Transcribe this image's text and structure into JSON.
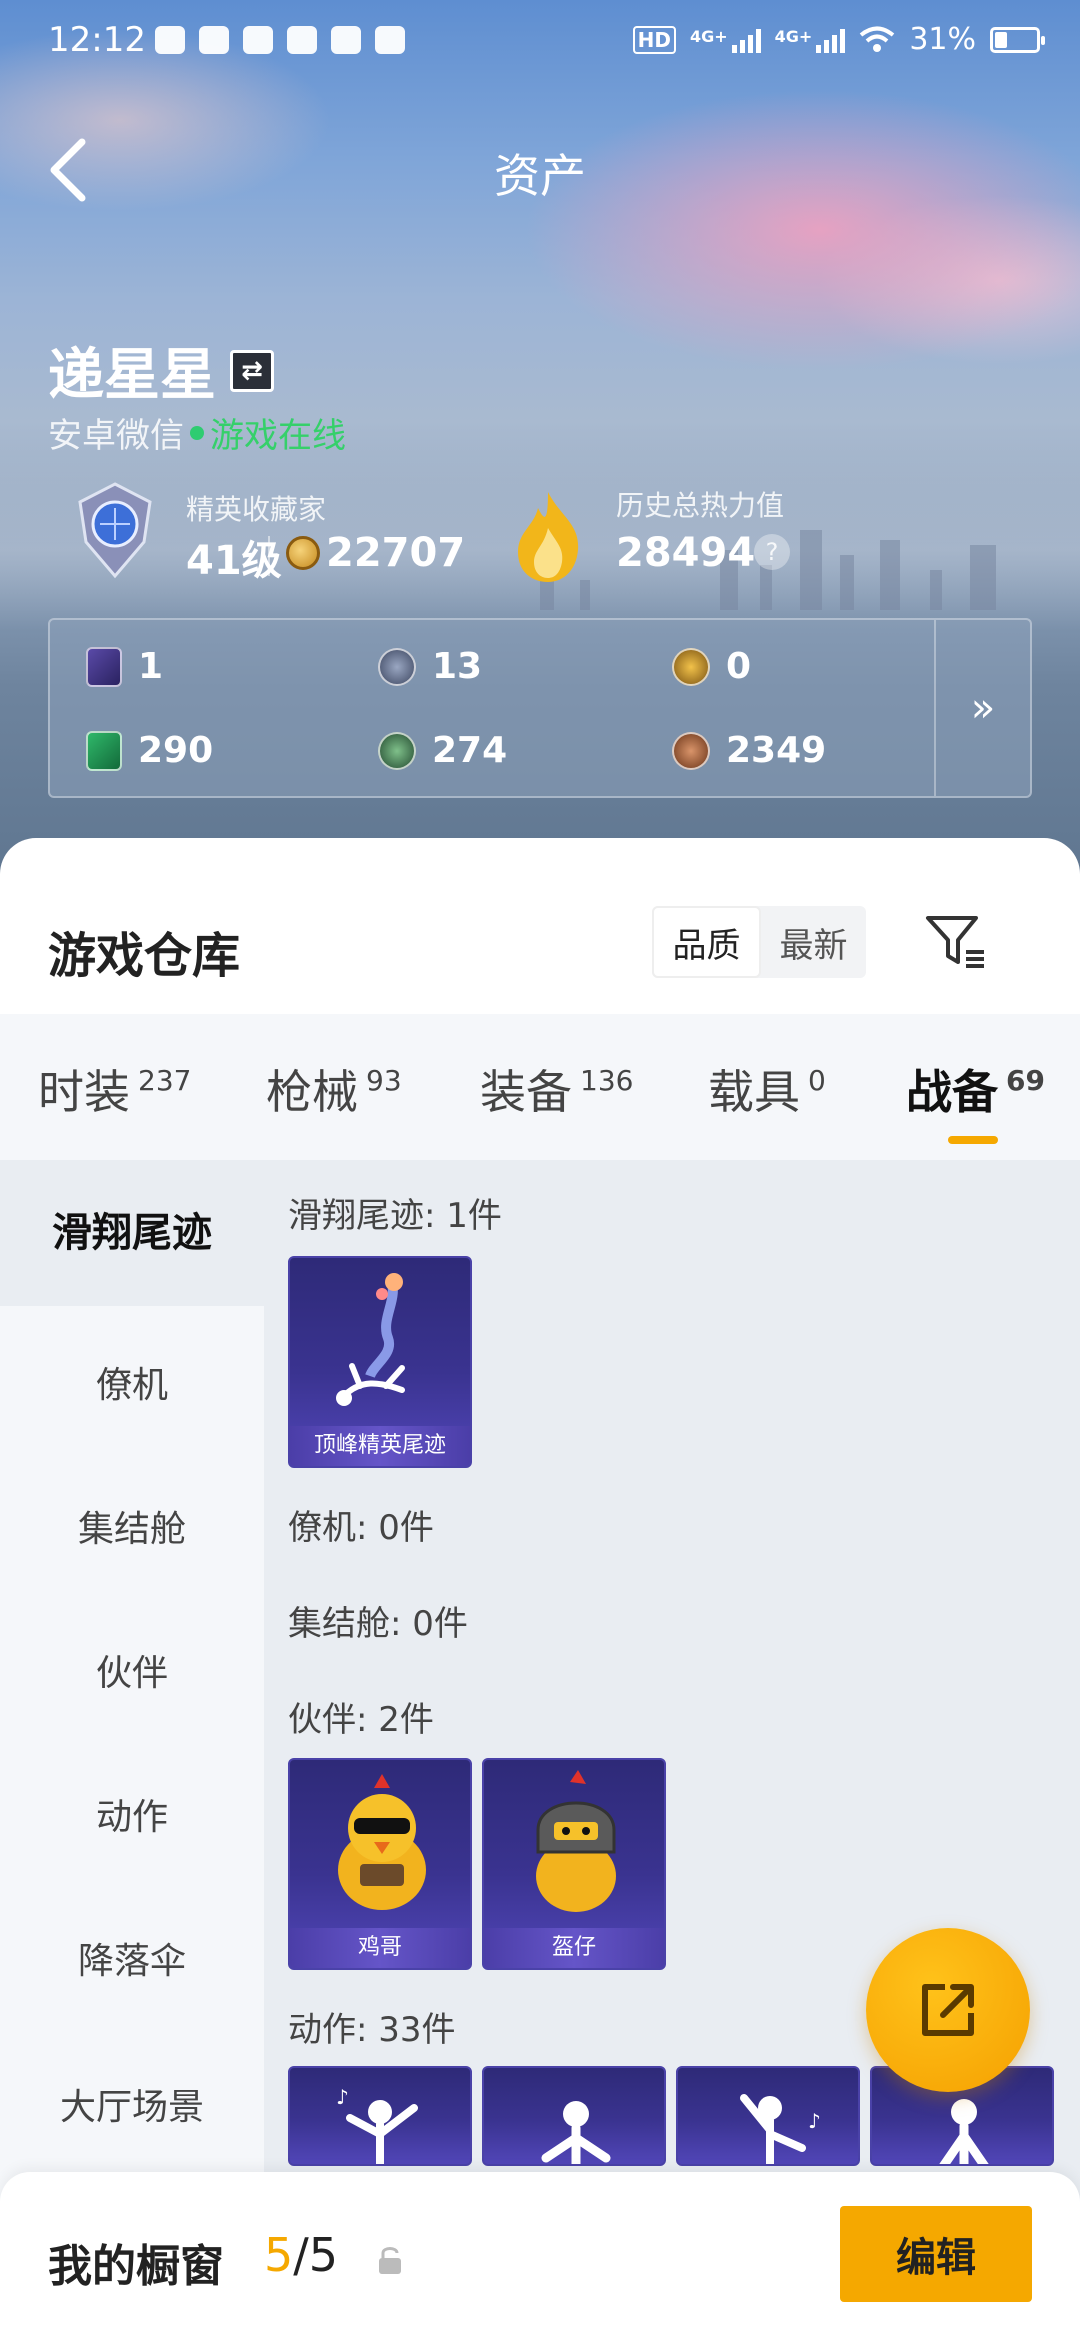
{
  "status_bar": {
    "time": "12:12",
    "network_1": "4G+",
    "network_2": "4G+",
    "hd_label": "HD",
    "battery": "31%"
  },
  "header": {
    "title": "资产"
  },
  "profile": {
    "name": "递星星",
    "platform": "安卓微信",
    "online_status": "游戏在线",
    "collector_label": "精英收藏家",
    "level": "41级",
    "collector_points": "22707",
    "heat_label": "历史总热力值",
    "heat_value": "28494",
    "help_mark": "?"
  },
  "currencies": [
    {
      "icon": "purple-card-icon",
      "value": "1"
    },
    {
      "icon": "silver-coin-icon",
      "value": "13"
    },
    {
      "icon": "gold-coin-icon",
      "value": "0"
    },
    {
      "icon": "green-ticket-icon",
      "value": "290"
    },
    {
      "icon": "green-coin-icon",
      "value": "274"
    },
    {
      "icon": "bronze-coin-icon",
      "value": "2349"
    }
  ],
  "currency_more": "»",
  "warehouse": {
    "title": "游戏仓库",
    "sort_options": [
      "品质",
      "最新"
    ],
    "sort_selected": "品质"
  },
  "tabs": [
    {
      "label": "时装",
      "count": "237"
    },
    {
      "label": "枪械",
      "count": "93"
    },
    {
      "label": "装备",
      "count": "136"
    },
    {
      "label": "载具",
      "count": "0"
    },
    {
      "label": "战备",
      "count": "69"
    }
  ],
  "active_tab": "战备",
  "sidebar": [
    {
      "label": "滑翔尾迹"
    },
    {
      "label": "僚机"
    },
    {
      "label": "集结舱"
    },
    {
      "label": "伙伴"
    },
    {
      "label": "动作"
    },
    {
      "label": "降落伞"
    },
    {
      "label": "大厅场景"
    }
  ],
  "sections": {
    "glide": {
      "title": "滑翔尾迹: 1件",
      "items": [
        "顶峰精英尾迹"
      ]
    },
    "wingman": {
      "title": "僚机: 0件"
    },
    "assembly": {
      "title": "集结舱: 0件"
    },
    "partner": {
      "title": "伙伴: 2件",
      "items": [
        "鸡哥",
        "盔仔"
      ]
    },
    "emote": {
      "title": "动作: 33件"
    }
  },
  "showcase": {
    "label": "我的橱窗",
    "current": "5",
    "separator": "/",
    "total": "5",
    "edit_label": "编辑"
  },
  "colors": {
    "accent": "#f5a800",
    "online": "#35d06a",
    "card_bg": "#3a3390"
  }
}
